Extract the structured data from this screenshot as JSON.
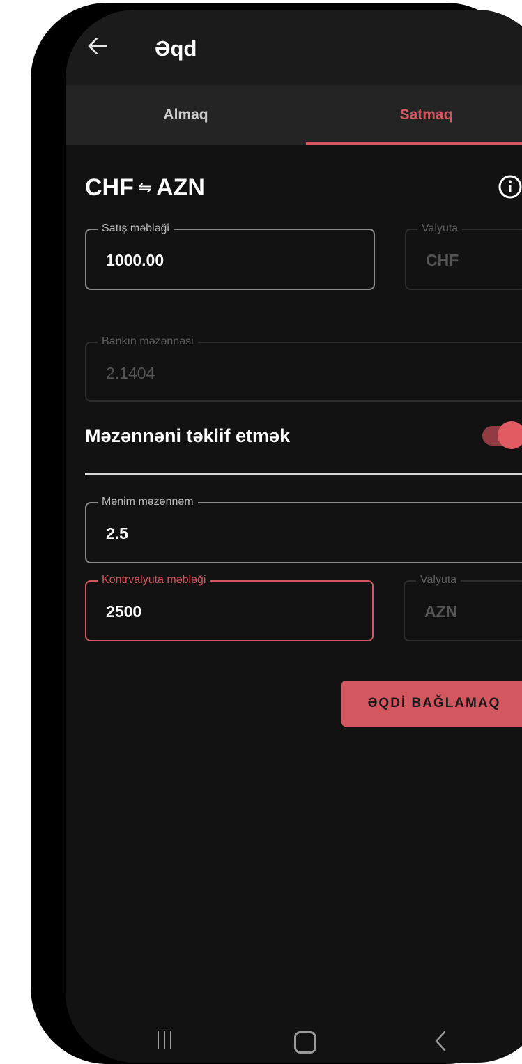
{
  "appbar": {
    "title": "Əqd"
  },
  "tabs": [
    {
      "label": "Almaq"
    },
    {
      "label": "Satmaq"
    }
  ],
  "pair": {
    "base": "CHF",
    "quote": "AZN"
  },
  "sell_amount": {
    "label": "Satış məbləği",
    "value": "1000.00"
  },
  "currency_top": {
    "label": "Valyuta",
    "value": "CHF"
  },
  "bank_rate": {
    "label": "Bankın məzənnəsi",
    "value": "2.1404"
  },
  "offer_rate": {
    "label": "Məzənnəni təklif etmək",
    "enabled": true
  },
  "my_rate": {
    "label": "Mənim məzənnəm",
    "value": "2.5"
  },
  "counter_amount": {
    "label": "Kontrvalyuta məbləği",
    "value": "2500"
  },
  "currency_bottom": {
    "label": "Valyuta",
    "value": "AZN"
  },
  "action": {
    "label": "ƏQDİ BAĞLAMAQ"
  },
  "colors": {
    "accent": "#d3575e",
    "background": "#121212"
  },
  "icons": [
    "arrow-left-icon",
    "swap-icon",
    "info-icon",
    "recent-apps-icon",
    "home-icon",
    "back-chevron-icon"
  ]
}
